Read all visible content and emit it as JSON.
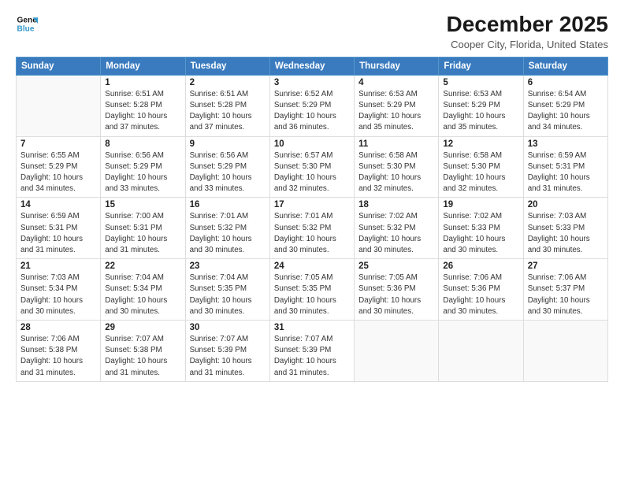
{
  "logo": {
    "line1": "General",
    "line2": "Blue"
  },
  "title": "December 2025",
  "location": "Cooper City, Florida, United States",
  "days_header": [
    "Sunday",
    "Monday",
    "Tuesday",
    "Wednesday",
    "Thursday",
    "Friday",
    "Saturday"
  ],
  "weeks": [
    [
      {
        "day": "",
        "info": ""
      },
      {
        "day": "1",
        "info": "Sunrise: 6:51 AM\nSunset: 5:28 PM\nDaylight: 10 hours\nand 37 minutes."
      },
      {
        "day": "2",
        "info": "Sunrise: 6:51 AM\nSunset: 5:28 PM\nDaylight: 10 hours\nand 37 minutes."
      },
      {
        "day": "3",
        "info": "Sunrise: 6:52 AM\nSunset: 5:29 PM\nDaylight: 10 hours\nand 36 minutes."
      },
      {
        "day": "4",
        "info": "Sunrise: 6:53 AM\nSunset: 5:29 PM\nDaylight: 10 hours\nand 35 minutes."
      },
      {
        "day": "5",
        "info": "Sunrise: 6:53 AM\nSunset: 5:29 PM\nDaylight: 10 hours\nand 35 minutes."
      },
      {
        "day": "6",
        "info": "Sunrise: 6:54 AM\nSunset: 5:29 PM\nDaylight: 10 hours\nand 34 minutes."
      }
    ],
    [
      {
        "day": "7",
        "info": "Sunrise: 6:55 AM\nSunset: 5:29 PM\nDaylight: 10 hours\nand 34 minutes."
      },
      {
        "day": "8",
        "info": "Sunrise: 6:56 AM\nSunset: 5:29 PM\nDaylight: 10 hours\nand 33 minutes."
      },
      {
        "day": "9",
        "info": "Sunrise: 6:56 AM\nSunset: 5:29 PM\nDaylight: 10 hours\nand 33 minutes."
      },
      {
        "day": "10",
        "info": "Sunrise: 6:57 AM\nSunset: 5:30 PM\nDaylight: 10 hours\nand 32 minutes."
      },
      {
        "day": "11",
        "info": "Sunrise: 6:58 AM\nSunset: 5:30 PM\nDaylight: 10 hours\nand 32 minutes."
      },
      {
        "day": "12",
        "info": "Sunrise: 6:58 AM\nSunset: 5:30 PM\nDaylight: 10 hours\nand 32 minutes."
      },
      {
        "day": "13",
        "info": "Sunrise: 6:59 AM\nSunset: 5:31 PM\nDaylight: 10 hours\nand 31 minutes."
      }
    ],
    [
      {
        "day": "14",
        "info": "Sunrise: 6:59 AM\nSunset: 5:31 PM\nDaylight: 10 hours\nand 31 minutes."
      },
      {
        "day": "15",
        "info": "Sunrise: 7:00 AM\nSunset: 5:31 PM\nDaylight: 10 hours\nand 31 minutes."
      },
      {
        "day": "16",
        "info": "Sunrise: 7:01 AM\nSunset: 5:32 PM\nDaylight: 10 hours\nand 30 minutes."
      },
      {
        "day": "17",
        "info": "Sunrise: 7:01 AM\nSunset: 5:32 PM\nDaylight: 10 hours\nand 30 minutes."
      },
      {
        "day": "18",
        "info": "Sunrise: 7:02 AM\nSunset: 5:32 PM\nDaylight: 10 hours\nand 30 minutes."
      },
      {
        "day": "19",
        "info": "Sunrise: 7:02 AM\nSunset: 5:33 PM\nDaylight: 10 hours\nand 30 minutes."
      },
      {
        "day": "20",
        "info": "Sunrise: 7:03 AM\nSunset: 5:33 PM\nDaylight: 10 hours\nand 30 minutes."
      }
    ],
    [
      {
        "day": "21",
        "info": "Sunrise: 7:03 AM\nSunset: 5:34 PM\nDaylight: 10 hours\nand 30 minutes."
      },
      {
        "day": "22",
        "info": "Sunrise: 7:04 AM\nSunset: 5:34 PM\nDaylight: 10 hours\nand 30 minutes."
      },
      {
        "day": "23",
        "info": "Sunrise: 7:04 AM\nSunset: 5:35 PM\nDaylight: 10 hours\nand 30 minutes."
      },
      {
        "day": "24",
        "info": "Sunrise: 7:05 AM\nSunset: 5:35 PM\nDaylight: 10 hours\nand 30 minutes."
      },
      {
        "day": "25",
        "info": "Sunrise: 7:05 AM\nSunset: 5:36 PM\nDaylight: 10 hours\nand 30 minutes."
      },
      {
        "day": "26",
        "info": "Sunrise: 7:06 AM\nSunset: 5:36 PM\nDaylight: 10 hours\nand 30 minutes."
      },
      {
        "day": "27",
        "info": "Sunrise: 7:06 AM\nSunset: 5:37 PM\nDaylight: 10 hours\nand 30 minutes."
      }
    ],
    [
      {
        "day": "28",
        "info": "Sunrise: 7:06 AM\nSunset: 5:38 PM\nDaylight: 10 hours\nand 31 minutes."
      },
      {
        "day": "29",
        "info": "Sunrise: 7:07 AM\nSunset: 5:38 PM\nDaylight: 10 hours\nand 31 minutes."
      },
      {
        "day": "30",
        "info": "Sunrise: 7:07 AM\nSunset: 5:39 PM\nDaylight: 10 hours\nand 31 minutes."
      },
      {
        "day": "31",
        "info": "Sunrise: 7:07 AM\nSunset: 5:39 PM\nDaylight: 10 hours\nand 31 minutes."
      },
      {
        "day": "",
        "info": ""
      },
      {
        "day": "",
        "info": ""
      },
      {
        "day": "",
        "info": ""
      }
    ]
  ]
}
